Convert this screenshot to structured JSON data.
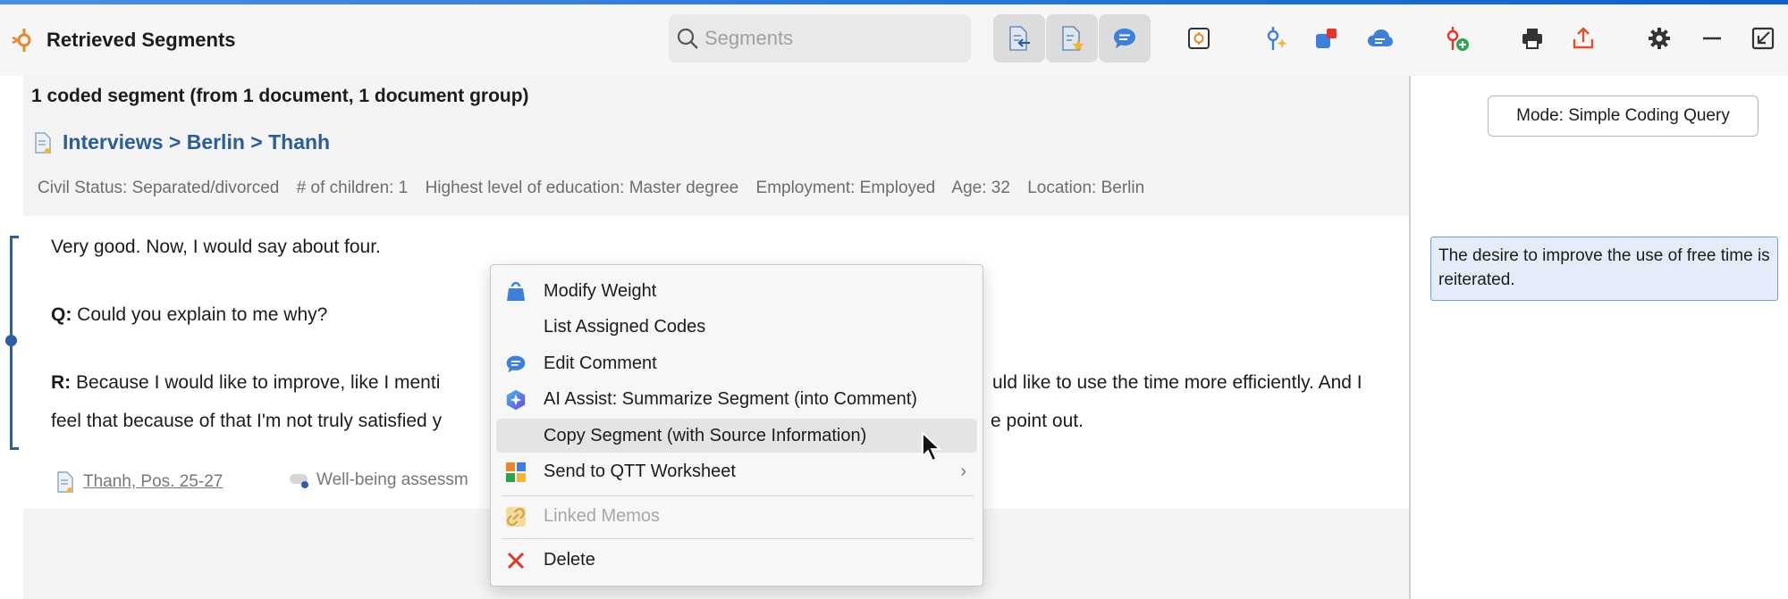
{
  "window": {
    "title": "Retrieved Segments"
  },
  "search": {
    "placeholder": "Segments"
  },
  "toolbar": {
    "buttons": [
      "doc-arrow-icon",
      "doc-star-icon",
      "comment-icon",
      "app-icon",
      "code-sparkle-icon",
      "code-square-icon",
      "cloud-icon",
      "code-add-icon",
      "print-icon",
      "export-icon",
      "gear-icon",
      "minimize-icon",
      "restore-icon"
    ]
  },
  "summary": "1 coded segment (from 1 document, 1 document group)",
  "document": {
    "path": "Interviews > Berlin > Thanh",
    "variables": [
      "Civil Status: Separated/divorced",
      "# of children: 1",
      "Highest level of education: Master degree",
      "Employment: Employed",
      "Age: 32",
      "Location: Berlin"
    ]
  },
  "segment": {
    "line1": "Very good. Now, I would say about four.",
    "q_label": "Q:",
    "q_text": "Could you explain to me why?",
    "r_label": "R:",
    "r_text_a": "Because I would like to improve, like I menti",
    "r_text_b": "uld like to use the time more efficiently. And I",
    "r_line2_a": "feel that because of that I'm not truly satisfied y",
    "r_line2_b": "e point out.",
    "source": "Thanh, Pos. 25-27",
    "code": "Well-being assessm"
  },
  "right_panel": {
    "mode_label": "Mode: Simple Coding Query",
    "comment": "The desire to improve the use of free time is reiterated."
  },
  "context_menu": {
    "items": [
      {
        "label": "Modify Weight",
        "icon": "weight-icon"
      },
      {
        "label": "List Assigned Codes",
        "icon": ""
      },
      {
        "label": "Edit Comment",
        "icon": "comment-icon"
      },
      {
        "label": "AI Assist: Summarize Segment (into Comment)",
        "icon": "ai-assist-icon"
      },
      {
        "label": "Copy Segment (with Source Information)",
        "icon": "",
        "highlighted": true
      },
      {
        "label": "Send to QTT Worksheet",
        "icon": "qtt-icon",
        "submenu": true
      },
      {
        "label": "Linked Memos",
        "icon": "link-icon",
        "disabled": true
      },
      {
        "label": "Delete",
        "icon": "delete-icon"
      }
    ]
  },
  "colors": {
    "accent": "#2a5d9a",
    "comment_bg": "#e3ecf8",
    "delete": "#e0362c"
  }
}
